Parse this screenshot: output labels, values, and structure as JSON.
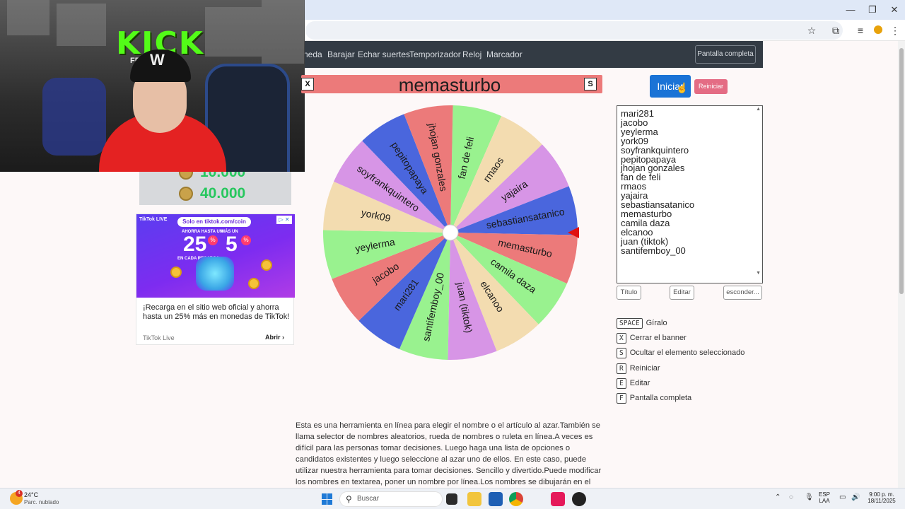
{
  "browser": {
    "minimize": "—",
    "restore": "❐",
    "close": "✕"
  },
  "navbar": {
    "links": [
      "neda",
      "Barajar",
      "Echar suertes",
      "Temporizador",
      "Reloj",
      "Marcador"
    ],
    "fullscreen": "Pantalla completa"
  },
  "webcam": {
    "logo_text": "KICK",
    "logo_sub": "FE",
    "cap_logo": "W"
  },
  "coins": {
    "partial_value": "10.000",
    "value": "40.000"
  },
  "ad": {
    "brand": "TikTok LIVE",
    "pill": "Solo en tiktok.com/coin",
    "up_to": "AHORRA HASTA UN",
    "big1": "25",
    "big2": "5",
    "more": "MÁS UN",
    "per_recharge": "EN CADA RECARGA",
    "text": "¡Recarga en el sitio web oficial y ahorra hasta un 25% más en monedas de TikTok!",
    "source": "TikTok Live",
    "open": "Abrir"
  },
  "banner": {
    "close_key": "X",
    "title": "memasturbo",
    "hide_key": "S"
  },
  "wheel": {
    "segments": [
      {
        "name": "fan de feli",
        "color": "#99f28f"
      },
      {
        "name": "rmaos",
        "color": "#f3dcb0"
      },
      {
        "name": "yajaira",
        "color": "#d795e6"
      },
      {
        "name": "sebastiansatanico",
        "color": "#4a66dd"
      },
      {
        "name": "memasturbo",
        "color": "#ec7a7a"
      },
      {
        "name": "camila daza",
        "color": "#99f28f"
      },
      {
        "name": "elcanoo",
        "color": "#f3dcb0"
      },
      {
        "name": "juan (tiktok)",
        "color": "#d795e6"
      },
      {
        "name": "santifemboy_00",
        "color": "#99f28f"
      },
      {
        "name": "mari281",
        "color": "#4a66dd"
      },
      {
        "name": "jacobo",
        "color": "#ec7a7a"
      },
      {
        "name": "yeylerma",
        "color": "#99f28f"
      },
      {
        "name": "york09",
        "color": "#f3dcb0"
      },
      {
        "name": "soyfrankquintero",
        "color": "#d795e6"
      },
      {
        "name": "pepitopapaya",
        "color": "#4a66dd"
      },
      {
        "name": "jhojan gonzales",
        "color": "#ec7a7a"
      }
    ],
    "pointer_color": "#e01010"
  },
  "controls": {
    "start": "Iniciar",
    "reset": "Reiniciar",
    "title_btn": "Título",
    "edit_btn": "Editar",
    "hide_btn": "esconder..."
  },
  "names": [
    "mari281",
    "jacobo",
    "yeylerma",
    "york09",
    "soyfrankquintero",
    "pepitopapaya",
    "jhojan gonzales",
    "fan de feli",
    "rmaos",
    "yajaira",
    "sebastiansatanico",
    "memasturbo",
    "camila daza",
    "elcanoo",
    "juan (tiktok)",
    "santifemboy_00"
  ],
  "shortcuts": [
    {
      "key": "SPACE",
      "label": "Gíralo"
    },
    {
      "key": "X",
      "label": "Cerrar el banner"
    },
    {
      "key": "S",
      "label": "Ocultar el elemento seleccionado"
    },
    {
      "key": "R",
      "label": "Reiniciar"
    },
    {
      "key": "E",
      "label": "Editar"
    },
    {
      "key": "F",
      "label": "Pantalla completa"
    }
  ],
  "description": "Esta es una herramienta en línea para elegir el nombre o el artículo al azar.También se llama selector de nombres aleatorios, rueda de nombres o ruleta en línea.A veces es difícil para las personas tomar decisiones. Luego haga una lista de opciones o candidatos existentes y luego seleccione al azar uno de ellos. En este caso, puede utilizar nuestra herramienta para tomar decisiones. Sencillo y divertido.Puede modificar los nombres en textarea, poner un nombre por línea.Los nombres se dibujarán en el círculo.Simplemente haga clic en la rueda",
  "taskbar": {
    "weather_badge": "4",
    "temperature": "24°C",
    "weather": "Parc. nublado",
    "search": "Buscar",
    "lang1": "ESP",
    "lang2": "LAA",
    "time": "9:00 p. m.",
    "date": "18/11/2025"
  }
}
